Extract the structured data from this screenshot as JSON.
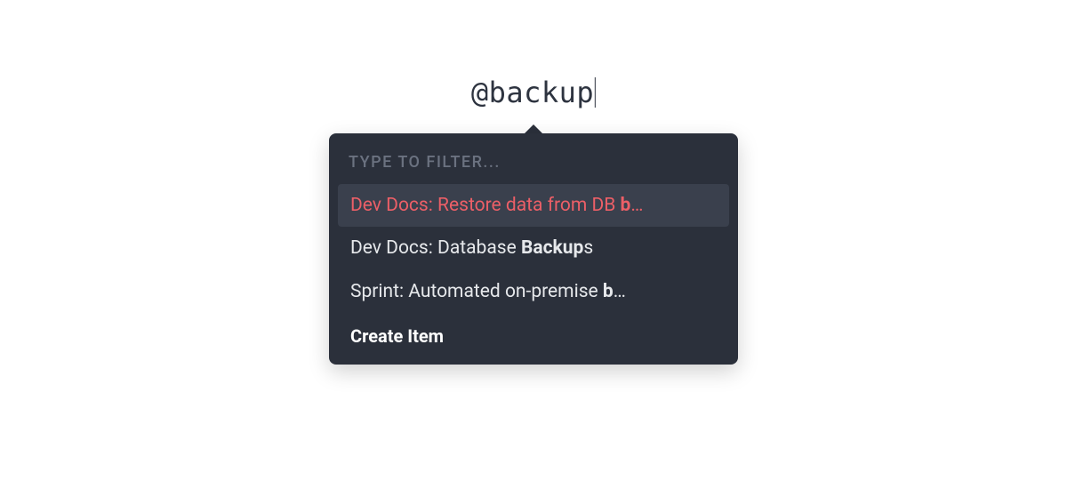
{
  "mention": {
    "prefix": "@",
    "query": "backup"
  },
  "popover": {
    "filter_placeholder": "TYPE TO FILTER...",
    "items": [
      {
        "prefix": "Dev Docs: Restore data from DB ",
        "match": "b",
        "suffix_ellipsis": "…",
        "selected": true
      },
      {
        "prefix": "Dev Docs: Database ",
        "match": "Backup",
        "suffix": "s",
        "selected": false
      },
      {
        "prefix": "Sprint: Automated on-premise ",
        "match": "b",
        "suffix_ellipsis": "…",
        "selected": false
      }
    ],
    "create_label": "Create Item"
  }
}
